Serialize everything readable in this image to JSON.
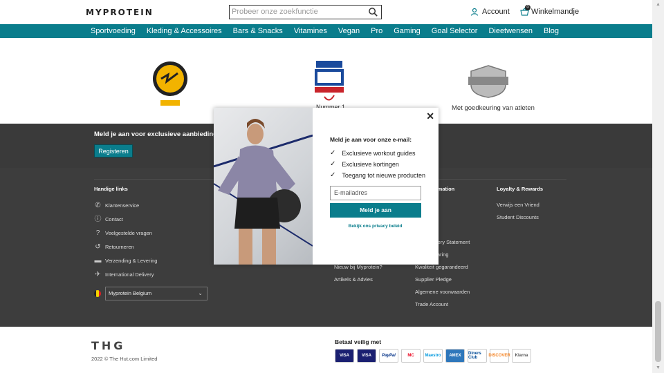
{
  "header": {
    "logo": "MYPROTEIN",
    "search_placeholder": "Probeer onze zoekfunctie",
    "account_label": "Account",
    "basket_label": "Winkelmandje",
    "basket_count": "0"
  },
  "nav": {
    "items": [
      "Sportvoeding",
      "Kleding & Accessoires",
      "Bars & Snacks",
      "Vitamines",
      "Vegan",
      "Pro",
      "Gaming",
      "Goal Selector",
      "Dieetwensen",
      "Blog"
    ]
  },
  "badges": {
    "fasttrack_label": "Nummer 1",
    "supplier_label": "Met goedkeuring van atleten"
  },
  "newsletter": {
    "title": "Meld je aan voor exclusieve aanbiedingen:",
    "button": "Registeren"
  },
  "footer": {
    "handy_links": {
      "heading": "Handige links",
      "items": [
        "Klantenservice",
        "Contact",
        "Veelgestelde vragen",
        "Retourneren",
        "Verzending & Levering",
        "International Delivery"
      ]
    },
    "about": {
      "items": [
        "Nieuw bij Myprotein?",
        "Artikels & Advies"
      ]
    },
    "info": {
      "heading": "Information",
      "items": [
        "Delivery Statement",
        "verklaring",
        "Kwaliteit gegarandeerd",
        "Supplier Pledge",
        "Algemene voorwaarden",
        "Trade Account"
      ]
    },
    "loyalty": {
      "heading": "Loyalty & Rewards",
      "items": [
        "Verwijs een Vriend",
        "Student Discounts"
      ]
    },
    "country": "Myprotein Belgium"
  },
  "bottom": {
    "company": "THG",
    "copyright": "2022 © The Hut.com Limited",
    "pay_title": "Betaal veilig met",
    "payments": [
      "VISA",
      "VISA",
      "PayPal",
      "MC",
      "Maestro",
      "AMEX",
      "Diners Club",
      "DISCOVER",
      "Klarna"
    ]
  },
  "modal": {
    "title": "Meld je aan voor onze e-mail:",
    "benefits": [
      "Exclusieve workout guides",
      "Exclusieve kortingen",
      "Toegang tot nieuwe producten"
    ],
    "email_placeholder": "E-mailadres",
    "submit": "Meld je aan",
    "privacy": "Bekijk ons privacy beleid"
  },
  "colors": {
    "brand": "#0a7d8c",
    "footer": "#3d3d3d"
  }
}
